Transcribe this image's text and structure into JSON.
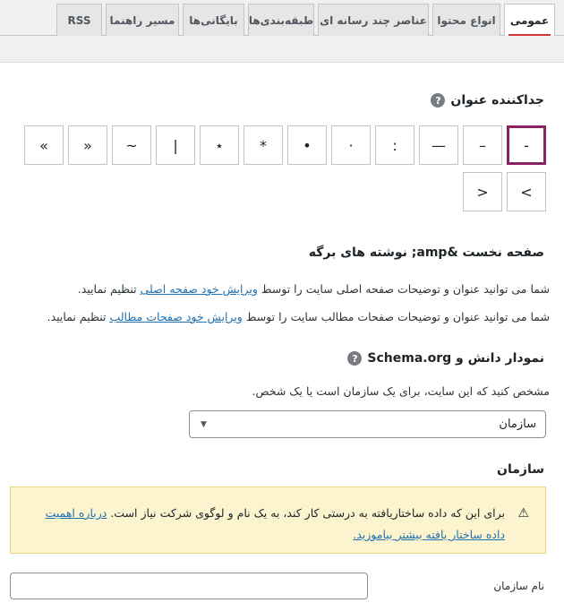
{
  "tabs": [
    {
      "label": "عمومی",
      "active": true
    },
    {
      "label": "انواع محتوا",
      "active": false
    },
    {
      "label": "عناصر چند رسانه ای",
      "active": false
    },
    {
      "label": "طبقه‌بندی‌ها",
      "active": false
    },
    {
      "label": "بایگانی‌ها",
      "active": false
    },
    {
      "label": "مسیر راهنما",
      "active": false
    },
    {
      "label": "RSS",
      "active": false
    }
  ],
  "title_separator": {
    "heading": "جداکننده عنوان",
    "help_icon": "question-circle-icon",
    "options": [
      "-",
      "–",
      "—",
      ":",
      "·",
      "•",
      "*",
      "⋆",
      "|",
      "~",
      "«",
      "»",
      ">",
      "<"
    ],
    "selected": "-"
  },
  "homepage_section": {
    "heading": "صفحه نخست &amp; نوشته های برگه",
    "line1_pre": "شما می توانید عنوان و توضیحات صفحه اصلی سایت را توسط ",
    "line1_link": "ویرایش خود صفحه اصلی",
    "line1_post": " تنظیم نمایید.",
    "line2_pre": "شما می توانید عنوان و توضیحات صفحات مطالب سایت را توسط ",
    "line2_link": "ویرایش خود صفحات مطالب",
    "line2_post": " تنظیم نمایید."
  },
  "knowledge_graph": {
    "heading": "نمودار دانش و Schema.org",
    "help_icon": "question-circle-icon",
    "description": "مشخص کنید که این سایت، برای یک سازمان است یا یک شخص.",
    "select_value": "سازمان",
    "caret_icon": "chevron-down-icon"
  },
  "organization": {
    "heading": "سازمان",
    "warning_icon": "warning-triangle-icon",
    "notice_text": "برای این که داده ساختاریافته به درستی کار کند، به یک نام و لوگوی شرکت نیاز است. ",
    "notice_link": "درباره اهمیت داده ساختار یافته بیشتر بیاموزید.",
    "name_label": "نام سازمان",
    "name_value": ""
  },
  "colors": {
    "accent": "#8b2362",
    "tab_underline": "#d63638",
    "link": "#2271b1",
    "notice_bg": "#fcf3cf"
  }
}
